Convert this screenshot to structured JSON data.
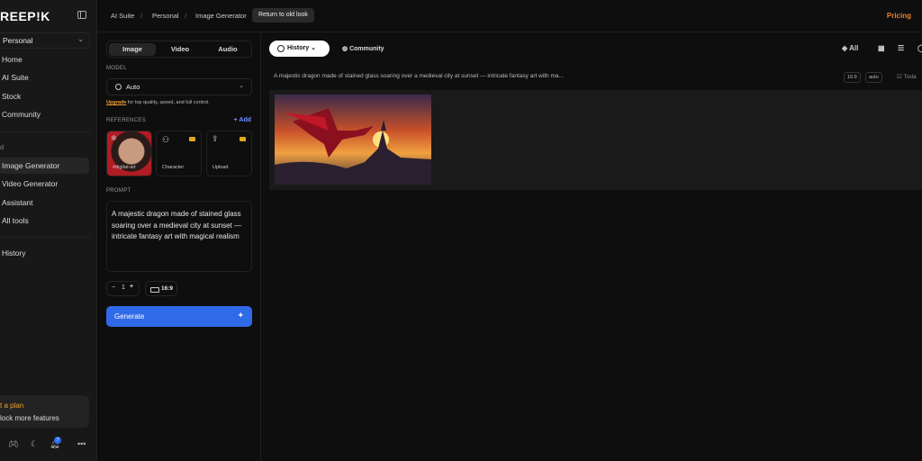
{
  "sidebar": {
    "logo": "REEP!K",
    "workspace": "Personal",
    "nav": [
      "Home",
      "AI Suite",
      "Stock",
      "Community"
    ],
    "section": "d",
    "tools": [
      "Image Generator",
      "Video Generator",
      "Assistant",
      "All tools"
    ],
    "history": "History",
    "plan_title": "t a plan",
    "plan_sub": "lock more features",
    "notifications": "7"
  },
  "header": {
    "breadcrumb": [
      "AI Suite",
      "Personal",
      "Image Generator"
    ],
    "old_look": "Return to old look",
    "pricing": "Pricing"
  },
  "panel": {
    "tabs": [
      "Image",
      "Video",
      "Audio"
    ],
    "model_label": "MODEL",
    "model": "Auto",
    "upgrade_link": "Upgrade",
    "upgrade_text": " for top quality, speed, and full control.",
    "references_label": "REFERENCES",
    "add": "Add",
    "refs": [
      "#digital-art",
      "Character",
      "Upload"
    ],
    "prompt_label": "PROMPT",
    "prompt": "A majestic dragon made of stained glass soaring over a medieval city at sunset — intricate fantasy art with magical realism",
    "count": "1",
    "ratio": "16:9",
    "generate": "Generate"
  },
  "main": {
    "history": "History",
    "community": "Community",
    "all": "All",
    "prompt_preview": "A majestic dragon made of stained glass soaring over a medieval city at sunset — intricate fantasy art with ma...",
    "ratio_chip": "16:9",
    "auto_chip": "auto",
    "today": "Toda"
  }
}
